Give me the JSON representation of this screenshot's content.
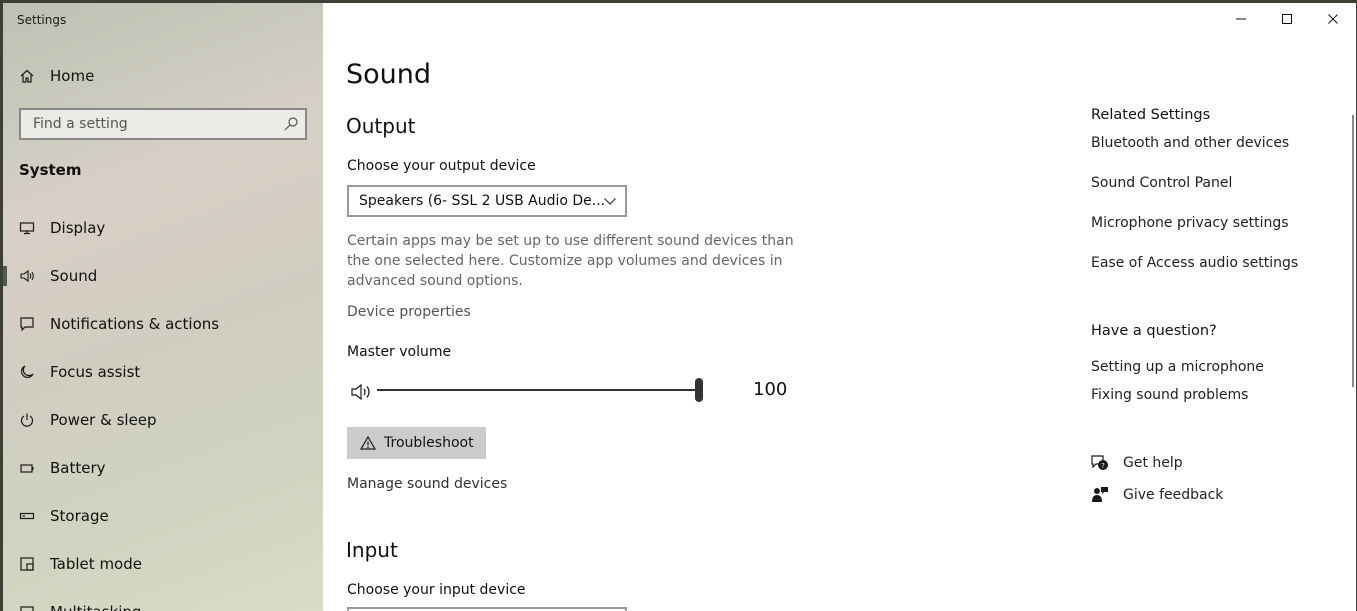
{
  "window": {
    "app_title": "Settings"
  },
  "sidebar": {
    "home_label": "Home",
    "search_placeholder": "Find a setting",
    "section_label": "System",
    "items": [
      {
        "label": "Display",
        "icon": "monitor-icon"
      },
      {
        "label": "Sound",
        "icon": "speaker-icon",
        "selected": true
      },
      {
        "label": "Notifications & actions",
        "icon": "notification-icon"
      },
      {
        "label": "Focus assist",
        "icon": "moon-icon"
      },
      {
        "label": "Power & sleep",
        "icon": "power-icon"
      },
      {
        "label": "Battery",
        "icon": "battery-icon"
      },
      {
        "label": "Storage",
        "icon": "storage-icon"
      },
      {
        "label": "Tablet mode",
        "icon": "tablet-icon"
      },
      {
        "label": "Multitasking",
        "icon": "multitasking-icon"
      }
    ]
  },
  "main": {
    "title": "Sound",
    "output": {
      "heading": "Output",
      "device_label": "Choose your output device",
      "device_value": "Speakers (6- SSL 2 USB Audio De...",
      "description": "Certain apps may be set up to use different sound devices than the one selected here. Customize app volumes and devices in advanced sound options.",
      "device_properties": "Device properties",
      "volume_label": "Master volume",
      "volume_value": "100",
      "troubleshoot_label": "Troubleshoot",
      "manage_devices": "Manage sound devices"
    },
    "input": {
      "heading": "Input",
      "device_label": "Choose your input device"
    }
  },
  "related": {
    "heading": "Related Settings",
    "links": [
      "Bluetooth and other devices",
      "Sound Control Panel",
      "Microphone privacy settings",
      "Ease of Access audio settings"
    ],
    "question_heading": "Have a question?",
    "question_links": [
      "Setting up a microphone",
      "Fixing sound problems"
    ],
    "get_help": "Get help",
    "give_feedback": "Give feedback"
  }
}
